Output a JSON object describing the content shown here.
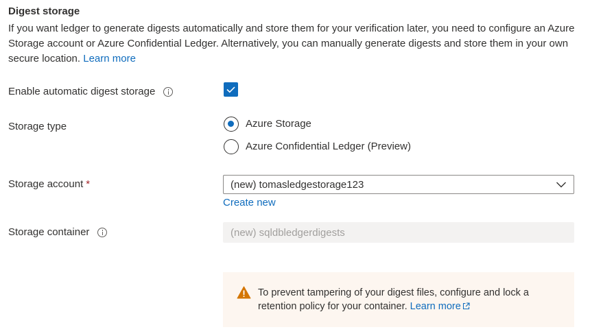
{
  "section": {
    "title": "Digest storage",
    "description": "If you want ledger to generate digests automatically and store them for your verification later, you need to configure an Azure Storage account or Azure Confidential Ledger. Alternatively, you can manually generate digests and store them in your own secure location.",
    "learn_more": "Learn more"
  },
  "enable_auto": {
    "label": "Enable automatic digest storage",
    "checked": true
  },
  "storage_type": {
    "label": "Storage type",
    "options": [
      {
        "label": "Azure Storage",
        "selected": true
      },
      {
        "label": "Azure Confidential Ledger (Preview)",
        "selected": false
      }
    ]
  },
  "storage_account": {
    "label": "Storage account",
    "required_marker": "*",
    "value": "(new) tomasledgestorage123",
    "create_new": "Create new"
  },
  "storage_container": {
    "label": "Storage container",
    "value": "(new) sqldbledgerdigests"
  },
  "warning": {
    "text": "To prevent tampering of your digest files, configure and lock a retention policy for your container.",
    "learn_more": "Learn more"
  },
  "colors": {
    "accent": "#0f6cbd",
    "warning_bg": "#fdf6f0",
    "warning_icon": "#d47500",
    "required": "#a4262c"
  }
}
